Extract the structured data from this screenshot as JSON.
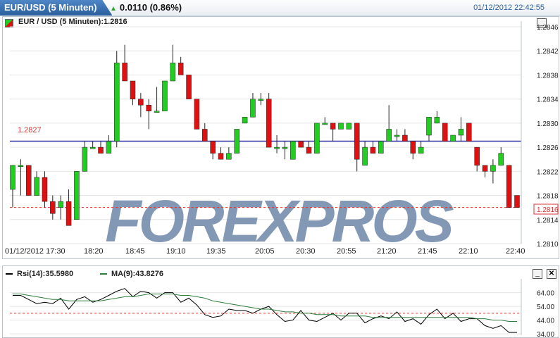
{
  "header": {
    "symbol_tab": "EUR/USD (5 Minuten)",
    "change": "0.0110 (0.86%)",
    "timestamp": "01/12/2012 22:42:55"
  },
  "main_chart": {
    "legend": "EUR / USD (5 Minuten):1.2816",
    "ref_line_label": "1.2827",
    "current_price_label": "1.2816"
  },
  "watermark": "FOREXPROS",
  "indicator_panel": {
    "rsi_legend": "Rsi(14):35.5980",
    "ma_legend": "MA(9):43.8276"
  },
  "icons": {
    "minimize": "minimize-icon",
    "close": "close-icon",
    "up_arrow": "up-arrow-icon"
  },
  "colors": {
    "up_candle": "#22cc22",
    "down_candle": "#dd1111",
    "ref_line": "#3333aa",
    "dashed_line": "#dd3333",
    "ma_line": "#2e7d3a",
    "rsi_line": "#000000"
  },
  "chart_data": [
    {
      "type": "candlestick",
      "title": "EUR / USD (5 Minuten)",
      "ylim": [
        1.281,
        1.2846
      ],
      "y_ticks": [
        "1.2846",
        "1.2842",
        "1.2838",
        "1.2834",
        "1.2830",
        "1.2826",
        "1.2822",
        "1.2818",
        "1.2814",
        "1.2810"
      ],
      "x_tick_labels": [
        "01/12/2012 17:30",
        "18:20",
        "18:45",
        "19:10",
        "19:35",
        "20:05",
        "20:30",
        "20:55",
        "21:20",
        "21:45",
        "22:10",
        "22:40"
      ],
      "reference_line": 1.2827,
      "last_price": 1.2816,
      "candles": [
        {
          "o": 1.2819,
          "h": 1.2823,
          "l": 1.2816,
          "c": 1.2823
        },
        {
          "o": 1.2823,
          "h": 1.2824,
          "l": 1.2818,
          "c": 1.2823
        },
        {
          "o": 1.2823,
          "h": 1.2823,
          "l": 1.2818,
          "c": 1.2818
        },
        {
          "o": 1.2818,
          "h": 1.2822,
          "l": 1.2818,
          "c": 1.2821
        },
        {
          "o": 1.2821,
          "h": 1.2822,
          "l": 1.2816,
          "c": 1.2817
        },
        {
          "o": 1.2817,
          "h": 1.2818,
          "l": 1.2814,
          "c": 1.2815
        },
        {
          "o": 1.2816,
          "h": 1.2818,
          "l": 1.2814,
          "c": 1.2817
        },
        {
          "o": 1.2817,
          "h": 1.2819,
          "l": 1.2813,
          "c": 1.2813
        },
        {
          "o": 1.2814,
          "h": 1.2822,
          "l": 1.2814,
          "c": 1.2822
        },
        {
          "o": 1.2822,
          "h": 1.2827,
          "l": 1.2822,
          "c": 1.2826
        },
        {
          "o": 1.2826,
          "h": 1.2827,
          "l": 1.2826,
          "c": 1.2826
        },
        {
          "o": 1.2826,
          "h": 1.2827,
          "l": 1.2825,
          "c": 1.2825
        },
        {
          "o": 1.2825,
          "h": 1.2828,
          "l": 1.2825,
          "c": 1.2827
        },
        {
          "o": 1.2827,
          "h": 1.2842,
          "l": 1.2826,
          "c": 1.284
        },
        {
          "o": 1.284,
          "h": 1.2843,
          "l": 1.2837,
          "c": 1.2837
        },
        {
          "o": 1.2837,
          "h": 1.2837,
          "l": 1.2833,
          "c": 1.2834
        },
        {
          "o": 1.2834,
          "h": 1.2835,
          "l": 1.2831,
          "c": 1.2833
        },
        {
          "o": 1.2833,
          "h": 1.2834,
          "l": 1.2829,
          "c": 1.2832
        },
        {
          "o": 1.2832,
          "h": 1.2836,
          "l": 1.2832,
          "c": 1.2832
        },
        {
          "o": 1.2832,
          "h": 1.2837,
          "l": 1.2832,
          "c": 1.2837
        },
        {
          "o": 1.2837,
          "h": 1.2843,
          "l": 1.2837,
          "c": 1.284
        },
        {
          "o": 1.284,
          "h": 1.2841,
          "l": 1.2838,
          "c": 1.2838
        },
        {
          "o": 1.2838,
          "h": 1.2838,
          "l": 1.2834,
          "c": 1.2834
        },
        {
          "o": 1.2834,
          "h": 1.2834,
          "l": 1.2829,
          "c": 1.2829
        },
        {
          "o": 1.2829,
          "h": 1.283,
          "l": 1.2827,
          "c": 1.2827
        },
        {
          "o": 1.2827,
          "h": 1.2827,
          "l": 1.2824,
          "c": 1.2825
        },
        {
          "o": 1.2825,
          "h": 1.2826,
          "l": 1.2824,
          "c": 1.2824
        },
        {
          "o": 1.2824,
          "h": 1.2826,
          "l": 1.2824,
          "c": 1.2825
        },
        {
          "o": 1.2825,
          "h": 1.2829,
          "l": 1.2825,
          "c": 1.2829
        },
        {
          "o": 1.283,
          "h": 1.2831,
          "l": 1.283,
          "c": 1.2831
        },
        {
          "o": 1.2831,
          "h": 1.2835,
          "l": 1.2831,
          "c": 1.2834
        },
        {
          "o": 1.2834,
          "h": 1.2835,
          "l": 1.2833,
          "c": 1.2834
        },
        {
          "o": 1.2834,
          "h": 1.2835,
          "l": 1.2826,
          "c": 1.2826
        },
        {
          "o": 1.2826,
          "h": 1.2828,
          "l": 1.2825,
          "c": 1.2826
        },
        {
          "o": 1.2826,
          "h": 1.2827,
          "l": 1.2824,
          "c": 1.2826
        },
        {
          "o": 1.2824,
          "h": 1.2827,
          "l": 1.2824,
          "c": 1.2827
        },
        {
          "o": 1.2827,
          "h": 1.2827,
          "l": 1.2826,
          "c": 1.2826
        },
        {
          "o": 1.2826,
          "h": 1.2827,
          "l": 1.2825,
          "c": 1.2825
        },
        {
          "o": 1.2825,
          "h": 1.283,
          "l": 1.2825,
          "c": 1.283
        },
        {
          "o": 1.283,
          "h": 1.2831,
          "l": 1.283,
          "c": 1.283
        },
        {
          "o": 1.283,
          "h": 1.283,
          "l": 1.2827,
          "c": 1.2829
        },
        {
          "o": 1.2829,
          "h": 1.283,
          "l": 1.2829,
          "c": 1.283
        },
        {
          "o": 1.2829,
          "h": 1.283,
          "l": 1.2829,
          "c": 1.283
        },
        {
          "o": 1.283,
          "h": 1.283,
          "l": 1.2822,
          "c": 1.2824
        },
        {
          "o": 1.2823,
          "h": 1.2827,
          "l": 1.2823,
          "c": 1.2826
        },
        {
          "o": 1.2826,
          "h": 1.2827,
          "l": 1.2825,
          "c": 1.2825
        },
        {
          "o": 1.2825,
          "h": 1.2827,
          "l": 1.2825,
          "c": 1.2827
        },
        {
          "o": 1.2827,
          "h": 1.2833,
          "l": 1.2827,
          "c": 1.2829
        },
        {
          "o": 1.2828,
          "h": 1.2829,
          "l": 1.2827,
          "c": 1.2828
        },
        {
          "o": 1.2828,
          "h": 1.2829,
          "l": 1.2827,
          "c": 1.2827
        },
        {
          "o": 1.2827,
          "h": 1.2827,
          "l": 1.2824,
          "c": 1.2825
        },
        {
          "o": 1.2825,
          "h": 1.2827,
          "l": 1.2825,
          "c": 1.2826
        },
        {
          "o": 1.2828,
          "h": 1.2831,
          "l": 1.2827,
          "c": 1.2831
        },
        {
          "o": 1.283,
          "h": 1.2832,
          "l": 1.283,
          "c": 1.2831
        },
        {
          "o": 1.283,
          "h": 1.283,
          "l": 1.2827,
          "c": 1.2827
        },
        {
          "o": 1.2827,
          "h": 1.2827,
          "l": 1.2827,
          "c": 1.2828
        },
        {
          "o": 1.2828,
          "h": 1.2831,
          "l": 1.2827,
          "c": 1.2829
        },
        {
          "o": 1.283,
          "h": 1.283,
          "l": 1.2827,
          "c": 1.2827
        },
        {
          "o": 1.2826,
          "h": 1.2826,
          "l": 1.2822,
          "c": 1.2823
        },
        {
          "o": 1.2823,
          "h": 1.2823,
          "l": 1.2821,
          "c": 1.2822
        },
        {
          "o": 1.2822,
          "h": 1.2824,
          "l": 1.282,
          "c": 1.2823
        },
        {
          "o": 1.2823,
          "h": 1.2826,
          "l": 1.2823,
          "c": 1.2825
        },
        {
          "o": 1.2823,
          "h": 1.2823,
          "l": 1.2816,
          "c": 1.2816
        },
        {
          "o": 1.2818,
          "h": 1.2818,
          "l": 1.2816,
          "c": 1.2816
        }
      ]
    },
    {
      "type": "line",
      "series": [
        {
          "name": "Rsi(14):35.5980",
          "values": [
            62,
            62,
            59,
            56,
            57,
            56,
            60,
            52,
            59,
            61,
            57,
            59,
            62,
            65,
            67,
            61,
            65,
            64,
            60,
            64,
            64,
            57,
            60,
            55,
            48,
            46,
            47,
            52,
            51,
            51,
            49,
            52,
            54,
            48,
            43,
            44,
            51,
            44,
            43,
            46,
            49,
            44,
            49,
            49,
            42,
            45,
            47,
            45,
            50,
            43,
            45,
            41,
            48,
            52,
            45,
            49,
            43,
            45,
            45,
            40,
            38,
            40,
            35,
            35
          ]
        },
        {
          "name": "MA(9):43.8276",
          "values": [
            63,
            63,
            62,
            61,
            60,
            59,
            59,
            58,
            58,
            58,
            58,
            58,
            59,
            60,
            61,
            61,
            62,
            63,
            63,
            63,
            63,
            62,
            62,
            61,
            60,
            58,
            57,
            56,
            55,
            54,
            53,
            52,
            52,
            51,
            50,
            50,
            49,
            49,
            48,
            48,
            48,
            47,
            47,
            47,
            47,
            46,
            46,
            46,
            46,
            46,
            46,
            46,
            46,
            46,
            46,
            46,
            46,
            46,
            45,
            45,
            44,
            44,
            43,
            43
          ]
        }
      ],
      "reference_line": 49,
      "ylim": [
        33,
        72
      ],
      "y_ticks": [
        "64.00",
        "54.00",
        "44.00",
        "34.00"
      ]
    }
  ]
}
